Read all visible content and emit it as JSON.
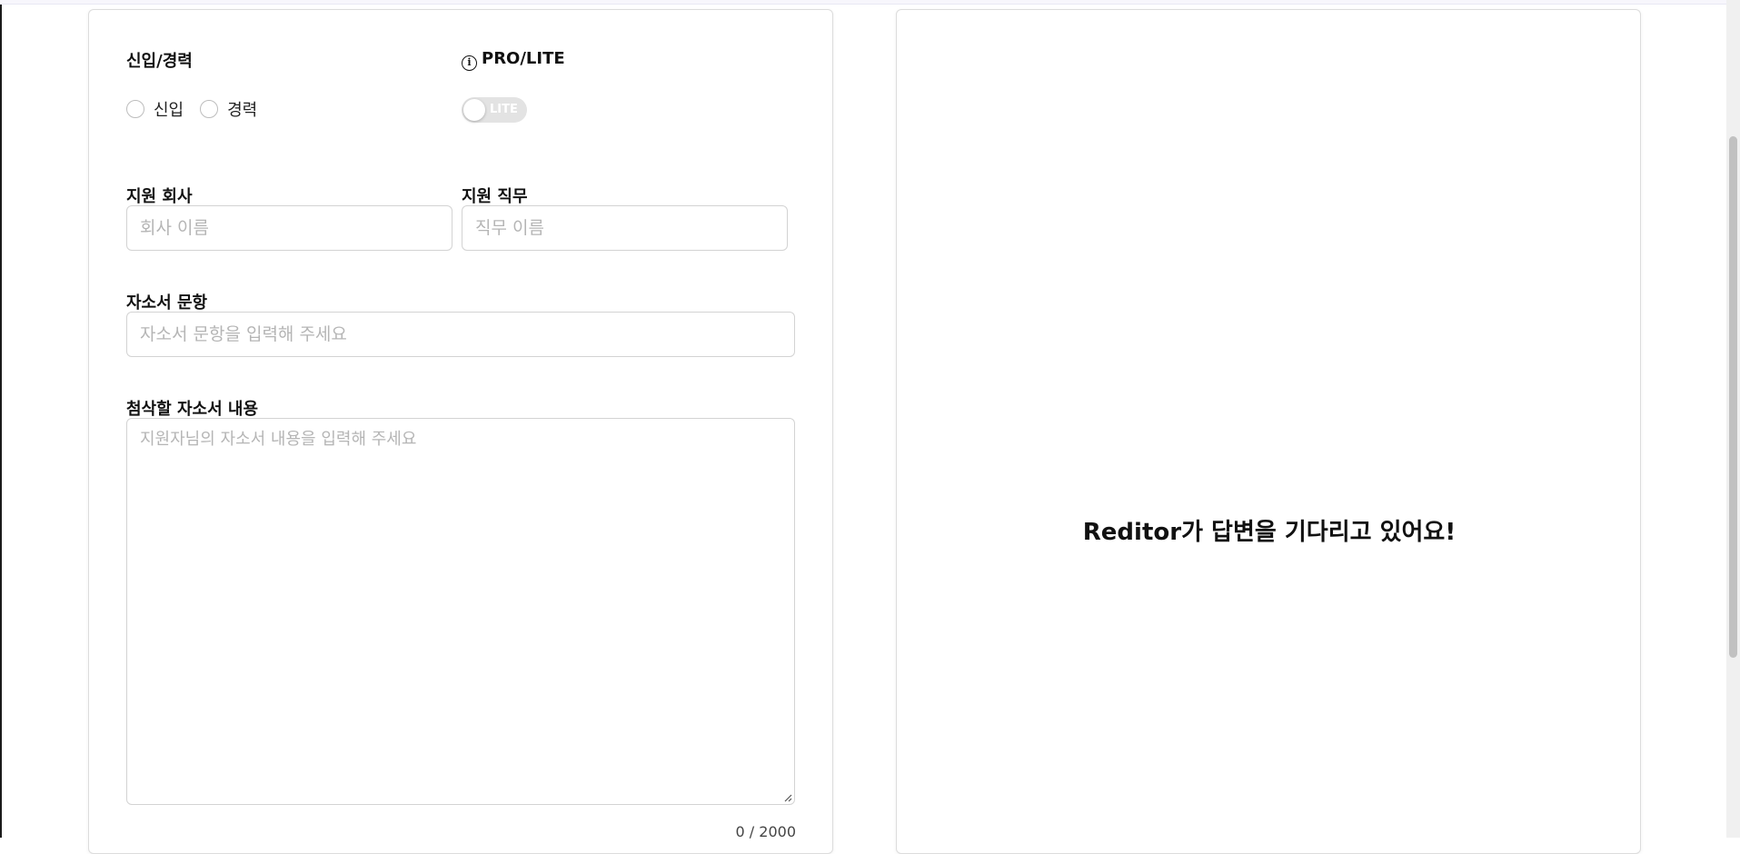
{
  "form": {
    "experience": {
      "label": "신입/경력",
      "options": [
        "신입",
        "경력"
      ]
    },
    "plan": {
      "label": "PRO/LITE",
      "info_icon": "info-icon",
      "toggle_text": "LITE",
      "toggle_state": "off"
    },
    "company": {
      "label": "지원 회사",
      "placeholder": "회사 이름",
      "value": ""
    },
    "job": {
      "label": "지원 직무",
      "placeholder": "직무 이름",
      "value": ""
    },
    "question": {
      "label": "자소서 문항",
      "placeholder": "자소서 문항을 입력해 주세요",
      "value": ""
    },
    "content": {
      "label": "첨삭할 자소서 내용",
      "placeholder": "지원자님의 자소서 내용을 입력해 주세요",
      "value": "",
      "counter": "0 / 2000"
    }
  },
  "result": {
    "waiting_message": "Reditor가 답변을 기다리고 있어요!"
  },
  "colors": {
    "toggle_off": "#e3e3e3",
    "border": "#d3d3d3",
    "placeholder": "#b5b5b5"
  }
}
